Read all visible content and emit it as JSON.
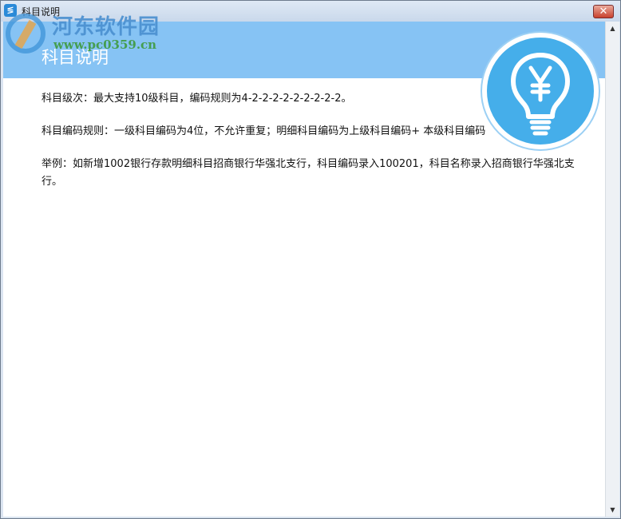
{
  "window": {
    "title": "科目说明",
    "close_label": "✕"
  },
  "watermark": {
    "name": "河东软件园",
    "url": "www.pc0359.cn"
  },
  "banner": {
    "title": "科目说明",
    "icon": "lightbulb-yen-icon"
  },
  "content": {
    "paragraphs": [
      "科目级次：最大支持10级科目，编码规则为4-2-2-2-2-2-2-2-2-2。",
      "科目编码规则：一级科目编码为4位，不允许重复；明细科目编码为上级科目编码+ 本级科目编码",
      "举例：如新增1002银行存款明细科目招商银行华强北支行，科目编码录入100201，科目名称录入招商银行华强北支行。"
    ]
  },
  "colors": {
    "banner": "#86c3f4",
    "icon_circle": "#45aeea",
    "close_button": "#c8402c"
  }
}
